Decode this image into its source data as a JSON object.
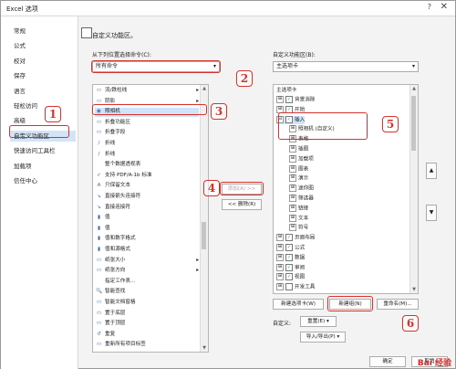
{
  "window": {
    "title": "Excel 选项",
    "help": "?",
    "close": "✕"
  },
  "nav": {
    "items": [
      "常规",
      "公式",
      "校对",
      "保存",
      "语言",
      "轻松访问",
      "高级",
      "自定义功能区",
      "快速访问工具栏",
      "加载项",
      "信任中心"
    ],
    "selected_index": 7
  },
  "header": {
    "title": "自定义功能区。"
  },
  "left": {
    "label": "从下列位置选择命令(C):",
    "combo_value": "所有命令",
    "items": [
      {
        "icon": "▭",
        "text": "流/跌柱线",
        "sub": "▸"
      },
      {
        "icon": "▭",
        "text": "阴影",
        "sub": "▸"
      },
      {
        "icon": "◉",
        "text": "照相机",
        "sub": ""
      },
      {
        "icon": "▭",
        "text": "折叠功能区",
        "sub": ""
      },
      {
        "icon": "▭",
        "text": "折叠字段",
        "sub": ""
      },
      {
        "icon": "∕",
        "text": "折线",
        "sub": ""
      },
      {
        "icon": "∕",
        "text": "折线",
        "sub": ""
      },
      {
        "icon": "",
        "text": "整个数据透视表",
        "sub": ""
      },
      {
        "icon": "✓",
        "text": "支持 PDF/A-1b 标准",
        "sub": ""
      },
      {
        "icon": "A",
        "text": "只保留文本",
        "sub": ""
      },
      {
        "icon": "↘",
        "text": "直接箭头连接符",
        "sub": ""
      },
      {
        "icon": "↘",
        "text": "直接连接符",
        "sub": ""
      },
      {
        "icon": "▮",
        "text": "值",
        "sub": ""
      },
      {
        "icon": "▮",
        "text": "值",
        "sub": ""
      },
      {
        "icon": "▮",
        "text": "值和数字格式",
        "sub": ""
      },
      {
        "icon": "▮",
        "text": "值和源格式",
        "sub": ""
      },
      {
        "icon": "▭",
        "text": "纸张大小",
        "sub": "▸"
      },
      {
        "icon": "▭",
        "text": "纸张方向",
        "sub": "▸"
      },
      {
        "icon": "",
        "text": "指定工作表...",
        "sub": ""
      },
      {
        "icon": "🔍",
        "text": "智能查找",
        "sub": ""
      },
      {
        "icon": "▭",
        "text": "智能文档窗格",
        "sub": ""
      },
      {
        "icon": "▭",
        "text": "置于底层",
        "sub": ""
      },
      {
        "icon": "▭",
        "text": "置于顶层",
        "sub": ""
      },
      {
        "icon": "↺",
        "text": "重复",
        "sub": ""
      },
      {
        "icon": "▭",
        "text": "重新所有项目标签",
        "sub": ""
      }
    ],
    "selected_index": 2
  },
  "middle": {
    "add_label": "添加(A) >>",
    "remove_label": "<< 删除(R)"
  },
  "right": {
    "label": "自定义功能区(B):",
    "combo_value": "主选项卡",
    "tree_header": "主选项卡",
    "tree": [
      {
        "indent": 0,
        "exp": "⊞",
        "cb": "✓",
        "text": "背景消除"
      },
      {
        "indent": 0,
        "exp": "⊞",
        "cb": "✓",
        "text": "开始"
      },
      {
        "indent": 0,
        "exp": "⊟",
        "cb": "✓",
        "text": "插入"
      },
      {
        "indent": 1,
        "exp": "⊞",
        "cb": "",
        "text": "照相机 (自定义)"
      },
      {
        "indent": 1,
        "exp": "⊞",
        "cb": "",
        "text": "表格"
      },
      {
        "indent": 1,
        "exp": "⊞",
        "cb": "",
        "text": "插图"
      },
      {
        "indent": 1,
        "exp": "⊞",
        "cb": "",
        "text": "加载项"
      },
      {
        "indent": 1,
        "exp": "⊞",
        "cb": "",
        "text": "图表"
      },
      {
        "indent": 1,
        "exp": "⊞",
        "cb": "",
        "text": "演示"
      },
      {
        "indent": 1,
        "exp": "⊞",
        "cb": "",
        "text": "迷你图"
      },
      {
        "indent": 1,
        "exp": "⊞",
        "cb": "",
        "text": "筛选器"
      },
      {
        "indent": 1,
        "exp": "⊞",
        "cb": "",
        "text": "链接"
      },
      {
        "indent": 1,
        "exp": "⊞",
        "cb": "",
        "text": "文本"
      },
      {
        "indent": 1,
        "exp": "⊞",
        "cb": "",
        "text": "符号"
      },
      {
        "indent": 0,
        "exp": "⊞",
        "cb": "✓",
        "text": "页面布局"
      },
      {
        "indent": 0,
        "exp": "⊞",
        "cb": "✓",
        "text": "公式"
      },
      {
        "indent": 0,
        "exp": "⊞",
        "cb": "✓",
        "text": "数据"
      },
      {
        "indent": 0,
        "exp": "⊞",
        "cb": "✓",
        "text": "审阅"
      },
      {
        "indent": 0,
        "exp": "⊞",
        "cb": "✓",
        "text": "视图"
      },
      {
        "indent": 0,
        "exp": "⊞",
        "cb": "",
        "text": "开发工具"
      }
    ],
    "new_tab": "新建选项卡(W)",
    "new_group": "新建组(N)",
    "rename": "重命名(M)...",
    "custom_label": "自定义:",
    "reset": "重置(E) ▾",
    "import_export": "导入/导出(P) ▾",
    "ok": "确定",
    "cancel": "取消"
  },
  "callouts": [
    "1",
    "2",
    "3",
    "4",
    "5",
    "6"
  ],
  "watermark": "Bai 经验"
}
